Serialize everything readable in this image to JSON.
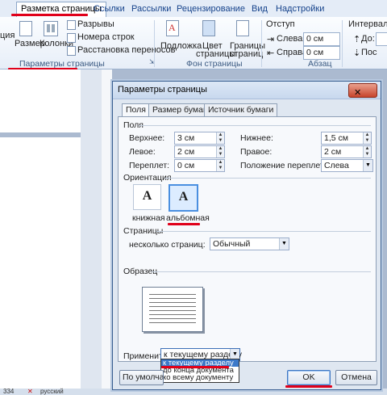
{
  "ribbon": {
    "tabs": [
      "Разметка страницы",
      "Ссылки",
      "Рассылки",
      "Рецензирование",
      "Вид",
      "Надстройки"
    ],
    "cut_label": "ция",
    "buttons": {
      "size": "Размер",
      "columns": "Колонки",
      "breaks": "Разрывы",
      "line_numbers": "Номера строк",
      "hyphenation": "Расстановка переносов",
      "watermark": "Подложка",
      "page_color": "Цвет страницы",
      "page_color_line1": "Цвет",
      "page_color_line2": "страницы",
      "page_borders": "Границы страниц",
      "page_borders_line1": "Границы",
      "page_borders_line2": "страниц"
    },
    "indent": {
      "title": "Отступ",
      "left_label": "Слева:",
      "left_value": "0 см",
      "right_label": "Справа:",
      "right_value": "0 см"
    },
    "spacing": {
      "title": "Интервал",
      "before_label": "До:",
      "after_label": "Пос"
    },
    "groups": [
      "Параметры страницы",
      "Фон страницы",
      "Абзац"
    ]
  },
  "statusbar": {
    "page_num": "334",
    "language": "русский"
  },
  "dialog": {
    "title": "Параметры страницы",
    "close_glyph": "✕",
    "tabs": [
      "Поля",
      "Размер бумаги",
      "Источник бумаги"
    ],
    "margins_title": "Поля",
    "fields": {
      "top_label": "Верхнее:",
      "top_value": "3 см",
      "bottom_label": "Нижнее:",
      "bottom_value": "1,5 см",
      "left_label": "Левое:",
      "left_value": "2 см",
      "right_label": "Правое:",
      "right_value": "2 см",
      "gutter_label": "Переплет:",
      "gutter_value": "0 см",
      "gutter_pos_label": "Положение переплета:",
      "gutter_pos_value": "Слева"
    },
    "orientation": {
      "title": "Ориентация",
      "portrait": "книжная",
      "landscape": "альбомная",
      "glyph": "A"
    },
    "pages": {
      "title": "Страницы",
      "multiple_label": "несколько страниц:",
      "multiple_value": "Обычный"
    },
    "preview_title": "Образец",
    "apply": {
      "label": "Применить:",
      "value": "к текущему разделу",
      "options": [
        "к текущему разделу",
        "до конца документа",
        "ко всему документу"
      ]
    },
    "buttons": {
      "default": "По умолчанию",
      "ok": "OK",
      "cancel": "Отмена"
    }
  }
}
